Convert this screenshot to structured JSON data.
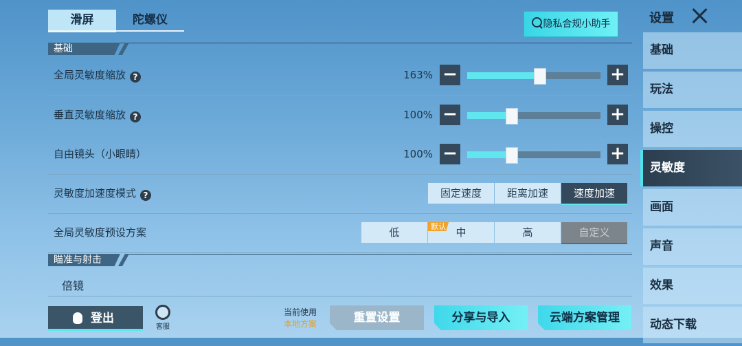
{
  "top_tabs": {
    "slide": "滑屏",
    "gyro": "陀螺仪"
  },
  "privacy_button": "隐私合规小助手",
  "sections": {
    "basic": "基础",
    "aim": "瞄准与射击"
  },
  "rows": {
    "global_sensitivity": {
      "label": "全局灵敏度缩放",
      "value": "163%",
      "level": 0.54
    },
    "vertical_sensitivity": {
      "label": "垂直灵敏度缩放",
      "value": "100%",
      "level": 0.33
    },
    "free_camera": {
      "label": "自由镜头（小眼睛）",
      "value": "100%",
      "level": 0.33
    },
    "accel_mode": {
      "label": "灵敏度加速度模式",
      "options": [
        "固定速度",
        "距离加速",
        "速度加速"
      ],
      "selected": "速度加速"
    },
    "preset": {
      "label": "全局灵敏度预设方案",
      "options": [
        "低",
        "中",
        "高",
        "自定义"
      ],
      "default_badge": "默认",
      "selected": "自定义"
    }
  },
  "scope_row": "倍镜",
  "bottom": {
    "logout": "登出",
    "service": "客服",
    "current_use_label": "当前使用",
    "current_use_value": "本地方案",
    "reset": "重置设置",
    "share": "分享与导入",
    "cloud": "云端方案管理"
  },
  "sidebar": {
    "title": "设置",
    "items": [
      "基础",
      "玩法",
      "操控",
      "灵敏度",
      "画面",
      "声音",
      "效果",
      "动态下载"
    ],
    "active": "灵敏度"
  },
  "colors": {
    "accent": "#5fe6ee",
    "dark": "#34495b",
    "badge": "#f0a32a"
  }
}
